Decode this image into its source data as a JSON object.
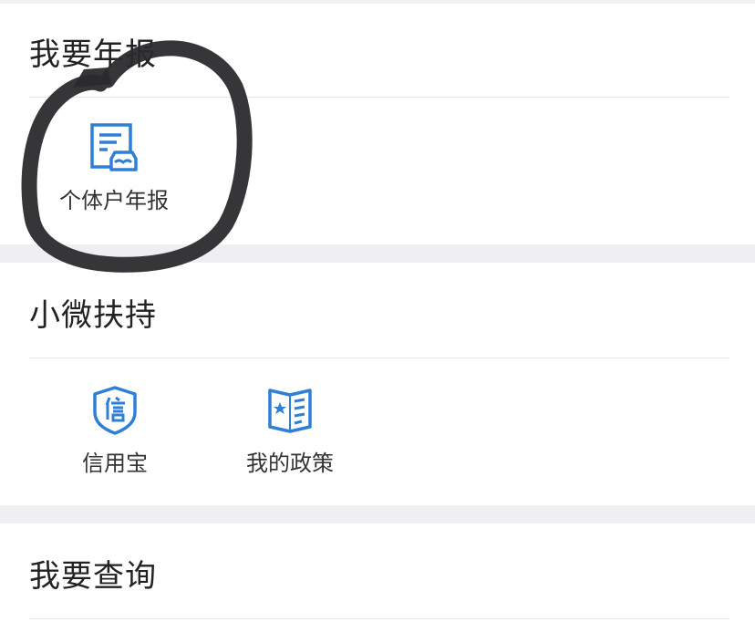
{
  "sections": [
    {
      "title": "我要年报",
      "items": [
        {
          "label": "个体户年报",
          "icon": "annual-report-icon"
        }
      ]
    },
    {
      "title": "小微扶持",
      "items": [
        {
          "label": "信用宝",
          "icon": "credit-shield-icon"
        },
        {
          "label": "我的政策",
          "icon": "policy-book-icon"
        }
      ]
    },
    {
      "title": "我要查询",
      "items": []
    }
  ],
  "colors": {
    "accent": "#2e7fd6",
    "marker": "#2b2b2e",
    "background": "#efeff1"
  }
}
